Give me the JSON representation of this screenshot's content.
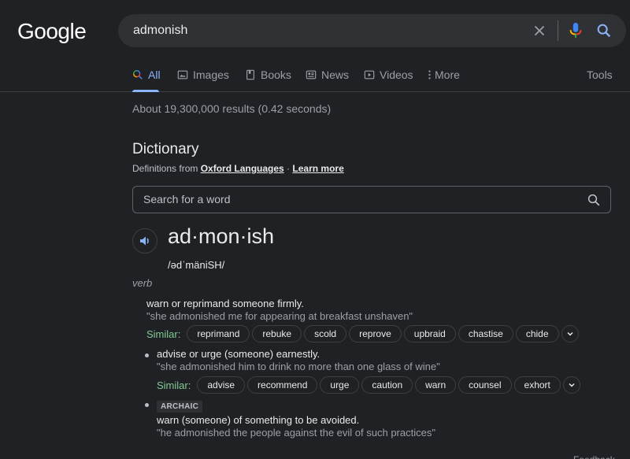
{
  "header": {
    "logo": "Google",
    "query": "admonish",
    "icons": [
      "clear-icon",
      "microphone-icon",
      "search-icon"
    ]
  },
  "tabs": [
    {
      "label": "All",
      "icon": "search-icon",
      "active": true
    },
    {
      "label": "Images",
      "icon": "image-icon",
      "active": false
    },
    {
      "label": "Books",
      "icon": "book-icon",
      "active": false
    },
    {
      "label": "News",
      "icon": "news-icon",
      "active": false
    },
    {
      "label": "Videos",
      "icon": "video-icon",
      "active": false
    },
    {
      "label": "More",
      "icon": "more-vert-icon",
      "active": false
    }
  ],
  "tools_label": "Tools",
  "result_stats": "About 19,300,000 results (0.42 seconds)",
  "dictionary": {
    "title": "Dictionary",
    "source_prefix": "Definitions from ",
    "source_link": "Oxford Languages",
    "separator": " · ",
    "learn_more": "Learn more",
    "search_placeholder": "Search for a word",
    "headword": "ad·mon·ish",
    "phonetic": "/ədˈmäniSH/",
    "part_of_speech": "verb",
    "similar_label": "Similar:",
    "senses": [
      {
        "definition": "warn or reprimand someone firmly.",
        "example": "\"she admonished me for appearing at breakfast unshaven\"",
        "similar": [
          "reprimand",
          "rebuke",
          "scold",
          "reprove",
          "upbraid",
          "chastise",
          "chide"
        ]
      },
      {
        "definition": "advise or urge (someone) earnestly.",
        "example": "\"she admonished him to drink no more than one glass of wine\"",
        "similar": [
          "advise",
          "recommend",
          "urge",
          "caution",
          "warn",
          "counsel",
          "exhort"
        ]
      },
      {
        "label": "ARCHAIC",
        "definition": "warn (someone) of something to be avoided.",
        "example": "\"he admonished the people against the evil of such practices\""
      }
    ]
  },
  "feedback": "Feedback",
  "colors": {
    "background": "#202124",
    "accent": "#8ab4f8",
    "similar_label": "#81c995"
  }
}
